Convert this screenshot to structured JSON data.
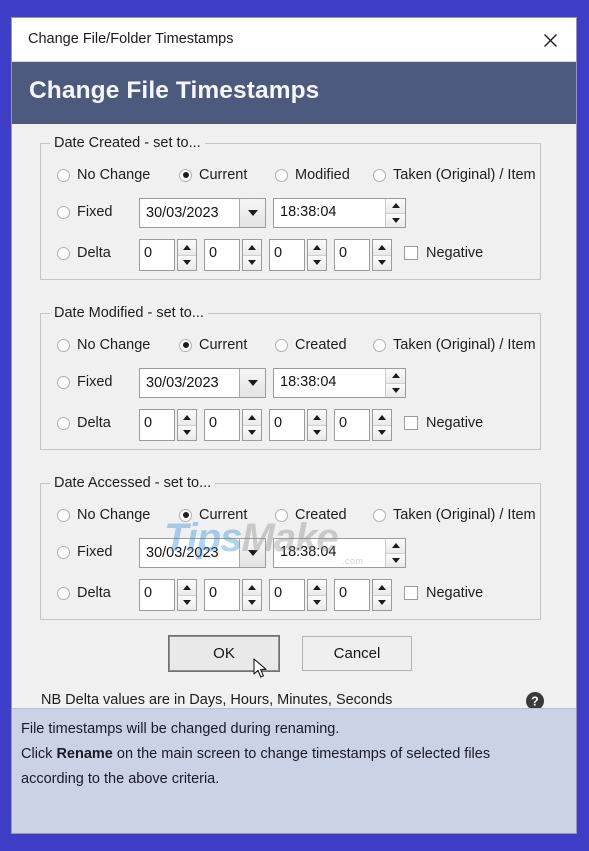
{
  "window": {
    "title": "Change File/Folder Timestamps",
    "close_icon": "close-icon"
  },
  "header": {
    "title": "Change File Timestamps"
  },
  "groups": [
    {
      "id": "created",
      "legend": "Date Created - set to...",
      "radios": [
        {
          "label": "No Change",
          "checked": false
        },
        {
          "label": "Current",
          "checked": true
        },
        {
          "label": "Modified",
          "checked": false
        },
        {
          "label": "Taken (Original) / Item Date",
          "checked": false
        }
      ],
      "fixed": {
        "label": "Fixed",
        "checked": false,
        "date": "30/03/2023",
        "time": "18:38:04"
      },
      "delta": {
        "label": "Delta",
        "checked": false,
        "values": [
          "0",
          "0",
          "0",
          "0"
        ],
        "negative_label": "Negative",
        "negative_checked": false
      }
    },
    {
      "id": "modified",
      "legend": "Date Modified - set to...",
      "radios": [
        {
          "label": "No Change",
          "checked": false
        },
        {
          "label": "Current",
          "checked": true
        },
        {
          "label": "Created",
          "checked": false
        },
        {
          "label": "Taken (Original) / Item Date",
          "checked": false
        }
      ],
      "fixed": {
        "label": "Fixed",
        "checked": false,
        "date": "30/03/2023",
        "time": "18:38:04"
      },
      "delta": {
        "label": "Delta",
        "checked": false,
        "values": [
          "0",
          "0",
          "0",
          "0"
        ],
        "negative_label": "Negative",
        "negative_checked": false
      }
    },
    {
      "id": "accessed",
      "legend": "Date Accessed - set to...",
      "radios": [
        {
          "label": "No Change",
          "checked": false
        },
        {
          "label": "Current",
          "checked": true
        },
        {
          "label": "Created",
          "checked": false
        },
        {
          "label": "Taken (Original) / Item Date",
          "checked": false
        }
      ],
      "fixed": {
        "label": "Fixed",
        "checked": false,
        "date": "30/03/2023",
        "time": "18:38:04"
      },
      "delta": {
        "label": "Delta",
        "checked": false,
        "values": [
          "0",
          "0",
          "0",
          "0"
        ],
        "negative_label": "Negative",
        "negative_checked": false
      }
    }
  ],
  "buttons": {
    "ok": "OK",
    "cancel": "Cancel"
  },
  "note": {
    "text": "NB Delta values are in Days, Hours, Minutes, Seconds",
    "help_icon": "help-icon"
  },
  "footer": {
    "line1": "File timestamps will be changed during renaming.",
    "line2_before": "Click ",
    "line2_bold": "Rename",
    "line2_after": " on the main screen to change timestamps of selected files",
    "line3": "according to the above criteria."
  },
  "watermark": {
    "part1": "Tips",
    "part2": "Make",
    "sub": ".com"
  },
  "colors": {
    "header_bg": "#4c5a7d",
    "dialog_bg": "#f0f0f0",
    "footer_bg": "#ccd2e6",
    "frame": "#3f3ec9"
  }
}
